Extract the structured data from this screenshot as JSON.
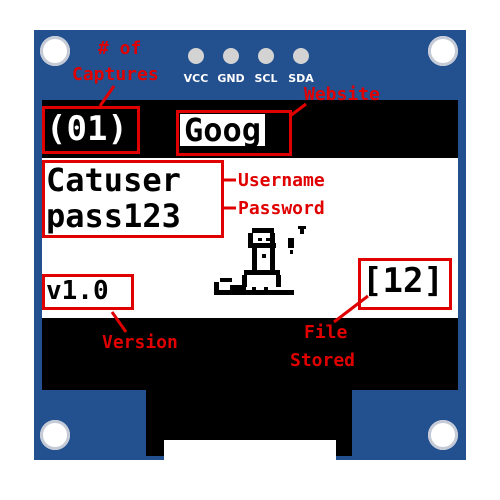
{
  "pins": [
    {
      "label": "VCC"
    },
    {
      "label": "GND"
    },
    {
      "label": "SCL"
    },
    {
      "label": "SDA"
    }
  ],
  "screen": {
    "captures": "(01)",
    "website": "Goog",
    "username": "Catuser",
    "password": "pass123",
    "version": "v1.0",
    "file_stored": "[12]"
  },
  "annotations": {
    "captures_line1": "# of",
    "captures_line2": "Captures",
    "website": "Website",
    "username": "Username",
    "password": "Password",
    "version": "Version",
    "file_line1": "File",
    "file_line2": "Stored"
  },
  "colors": {
    "board": "#23508f",
    "annotation": "#e00000",
    "screen_bg": "#000000",
    "content_bg": "#ffffff"
  }
}
